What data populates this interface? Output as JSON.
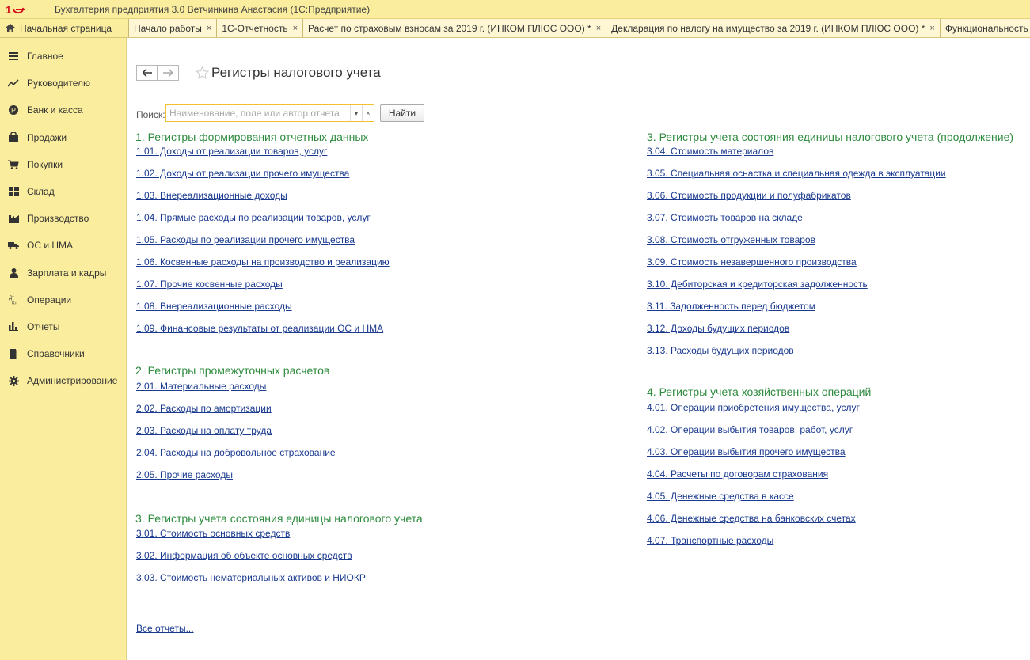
{
  "window": {
    "title": "Бухгалтерия предприятия 3.0 Ветчинкина Анастасия  (1С:Предприятие)"
  },
  "tabs": {
    "home": "Начальная страница",
    "items": [
      {
        "label": "Начало работы"
      },
      {
        "label": "1С-Отчетность"
      },
      {
        "label": "Расчет по страховым взносам за 2019 г. (ИНКОМ ПЛЮС ООО) *"
      },
      {
        "label": "Декларация по налогу на имущество за 2019 г. (ИНКОМ ПЛЮС ООО) *"
      },
      {
        "label": "Функциональность программы"
      }
    ],
    "close_glyph": "×"
  },
  "sidebar": {
    "items": [
      {
        "label": "Главное",
        "icon": "menu-icon"
      },
      {
        "label": "Руководителю",
        "icon": "chart-line-icon"
      },
      {
        "label": "Банк и касса",
        "icon": "ruble-coin-icon"
      },
      {
        "label": "Продажи",
        "icon": "shopping-bag-icon"
      },
      {
        "label": "Покупки",
        "icon": "cart-icon"
      },
      {
        "label": "Склад",
        "icon": "warehouse-icon"
      },
      {
        "label": "Производство",
        "icon": "factory-icon"
      },
      {
        "label": "ОС и НМА",
        "icon": "truck-icon"
      },
      {
        "label": "Зарплата и кадры",
        "icon": "person-icon"
      },
      {
        "label": "Операции",
        "icon": "dt-kt-icon"
      },
      {
        "label": "Отчеты",
        "icon": "bar-chart-icon"
      },
      {
        "label": "Справочники",
        "icon": "book-icon"
      },
      {
        "label": "Администрирование",
        "icon": "gear-icon"
      }
    ]
  },
  "page": {
    "title": "Регистры налогового учета",
    "search_label": "Поиск:",
    "search_placeholder": "Наименование, поле или автор отчета",
    "find_button": "Найти",
    "all_reports": "Все отчеты..."
  },
  "sections": {
    "s1": {
      "title": "1. Регистры формирования отчетных данных",
      "links": [
        "1.01. Доходы от реализации товаров, услуг",
        "1.02. Доходы от реализации прочего имущества",
        "1.03. Внереализационные доходы",
        "1.04. Прямые расходы по реализации товаров, услуг",
        "1.05. Расходы по реализации прочего имущества",
        "1.06. Косвенные расходы на производство и реализацию",
        "1.07. Прочие косвенные расходы",
        "1.08. Внереализационные расходы",
        "1.09. Финансовые результаты от реализации ОС и НМА"
      ]
    },
    "s2": {
      "title": "2. Регистры промежуточных расчетов",
      "links": [
        "2.01. Материальные расходы",
        "2.02. Расходы по амортизации",
        "2.03. Расходы на оплату труда",
        "2.04. Расходы на добровольное страхование",
        "2.05. Прочие расходы"
      ]
    },
    "s3": {
      "title": "3. Регистры учета состояния единицы налогового учета",
      "links": [
        "3.01. Стоимость основных средств",
        "3.02. Информация об объекте основных средств",
        "3.03. Стоимость нематериальных активов и НИОКР"
      ]
    },
    "s3b": {
      "title": "3. Регистры учета состояния единицы налогового учета (продолжение)",
      "links": [
        "3.04. Стоимость материалов",
        "3.05. Специальная оснастка и специальная одежда в эксплуатации",
        "3.06. Стоимость продукции и полуфабрикатов",
        "3.07. Стоимость товаров на складе",
        "3.08. Стоимость отгруженных товаров",
        "3.09. Стоимость незавершенного производства",
        "3.10. Дебиторская и кредиторская задолженность",
        "3.11. Задолженность перед бюджетом",
        "3.12. Доходы будущих периодов",
        "3.13. Расходы будущих периодов"
      ]
    },
    "s4": {
      "title": "4. Регистры учета хозяйственных операций",
      "links": [
        "4.01. Операции приобретения имущества, услуг",
        "4.02. Операции выбытия товаров, работ, услуг",
        "4.03. Операции выбытия прочего имущества",
        "4.04. Расчеты по договорам страхования",
        "4.05. Денежные средства в кассе",
        "4.06. Денежные средства на банковских счетах",
        "4.07. Транспортные расходы"
      ]
    }
  },
  "colors": {
    "panel": "#fbed9e",
    "section_title": "#2e8b3e",
    "link": "#1a3a8f",
    "logo": "#d6121c"
  }
}
